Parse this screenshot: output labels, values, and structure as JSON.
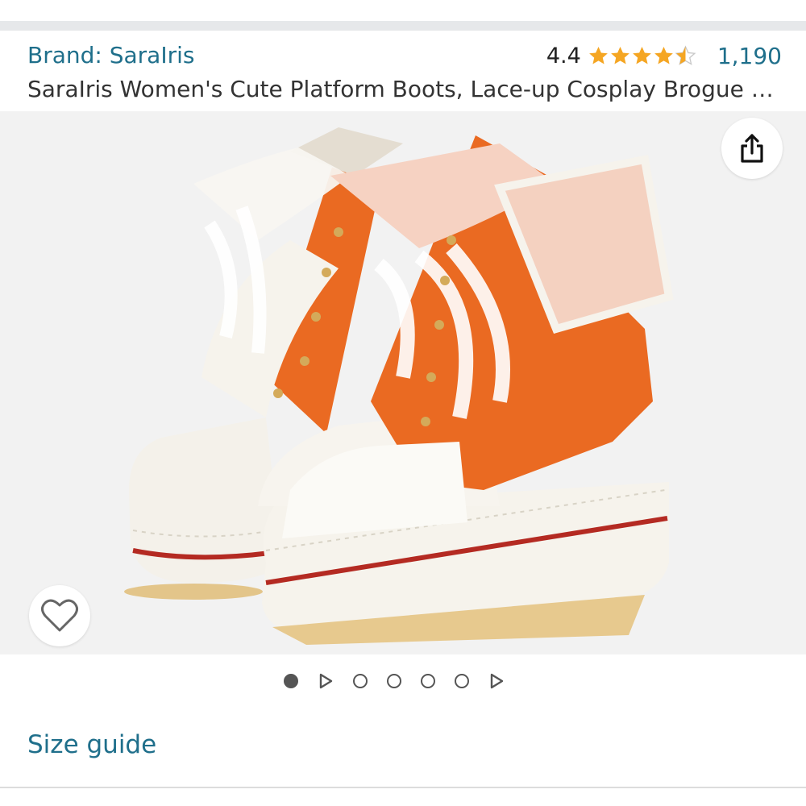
{
  "header": {
    "brand_label": "Brand: SaraIris",
    "rating_value": "4.4",
    "rating_stars": 4.4,
    "review_count": "1,190"
  },
  "product": {
    "title": "SaraIris Women's Cute Platform Boots, Lace-up Cosplay Brogue S…"
  },
  "gallery": {
    "share_icon": "share-icon",
    "wishlist_icon": "heart-icon",
    "indicators": [
      "dot-active",
      "video",
      "dot",
      "dot",
      "dot",
      "dot",
      "video"
    ]
  },
  "links": {
    "size_guide": "Size guide"
  },
  "colors": {
    "link": "#1f6f8b",
    "star": "#f5a623",
    "boot_orange": "#ea6a22"
  }
}
